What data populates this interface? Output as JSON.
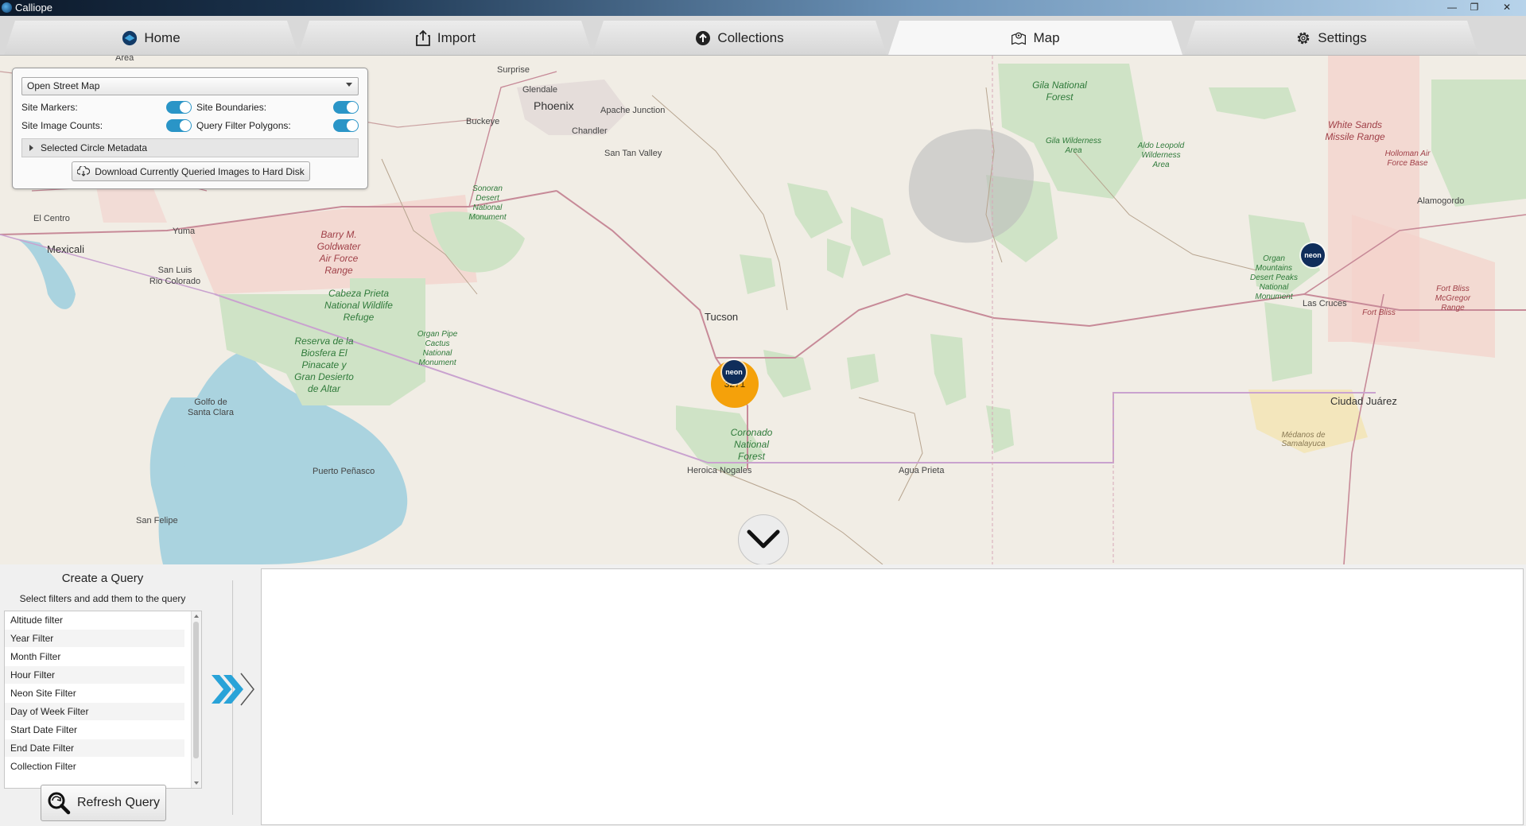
{
  "window": {
    "title": "Calliope",
    "controls": [
      "minimize-icon",
      "restore-icon",
      "close-icon"
    ]
  },
  "tabs": [
    {
      "label": "Home",
      "icon": "calliope-logo-icon",
      "active": false
    },
    {
      "label": "Import",
      "icon": "import-icon",
      "active": false
    },
    {
      "label": "Collections",
      "icon": "upload-circle-icon",
      "active": false
    },
    {
      "label": "Map",
      "icon": "map-pin-icon",
      "active": true
    },
    {
      "label": "Settings",
      "icon": "gear-icon",
      "active": false
    }
  ],
  "map_panel": {
    "layer": "Open Street Map",
    "site_markers_label": "Site Markers:",
    "site_markers_on": true,
    "site_boundaries_label": "Site Boundaries:",
    "site_boundaries_on": true,
    "site_image_counts_label": "Site Image Counts:",
    "site_image_counts_on": true,
    "query_filter_polygons_label": "Query Filter Polygons:",
    "query_filter_polygons_on": true,
    "metadata_label": "Selected Circle Metadata",
    "download_label": "Download Currently Queried Images to Hard Disk"
  },
  "map": {
    "markers": [
      {
        "label": "neon",
        "type": "neon-site-marker"
      },
      {
        "label": "neon",
        "type": "neon-site-marker"
      }
    ],
    "cluster_count": "3271",
    "labels": {
      "area": "Area",
      "surprise": "Surprise",
      "glendale": "Glendale",
      "phoenix": "Phoenix",
      "apache_junction": "Apache Junction",
      "buckeye": "Buckeye",
      "chandler": "Chandler",
      "san_tan_valley": "San Tan Valley",
      "el_centro": "El Centro",
      "yuma": "Yuma",
      "mexicali": "Mexicali",
      "san_luis": "San Luis\nRio Colorado",
      "sonoran": "Sonoran Desert National Monument",
      "barry": "Barry M. Goldwater Air Force Range",
      "cabeza": "Cabeza Prieta National Wildlife Refuge",
      "organ_pipe": "Organ Pipe Cactus National Monument",
      "reserva": "Reserva de la Biosfera El Pinacate y Gran Desierto de Altar",
      "tucson": "Tucson",
      "golfo": "Golfo de\nSanta Clara",
      "puerto": "Puerto Peñasco",
      "san_felipe": "San Felipe",
      "heroica": "Heroica Nogales",
      "agua_prieta": "Agua Prieta",
      "coronado": "Coronado National Forest",
      "gila_nf": "Gila National Forest",
      "gila_wild": "Gila Wilderness Area",
      "aldo": "Aldo Leopold Wilderness Area",
      "white_sands": "White Sands Missile Range",
      "holloman": "Holloman Air Force Base",
      "alamogordo": "Alamogordo",
      "organ_mtn": "Organ Mountains Desert Peaks National Monument",
      "las_cruces": "Las Cruces",
      "fort_bliss": "Fort Bliss",
      "fort_bliss_mcg": "Fort Bliss McGregor Range",
      "ciudad_juarez": "Ciudad Juárez",
      "medanos": "Médanos de Samalayuca"
    },
    "collapse_icon": "chevron-down-icon"
  },
  "query": {
    "title": "Create a Query",
    "subtitle": "Select filters and add them to the query",
    "filters": [
      "Altitude filter",
      "Year Filter",
      "Month Filter",
      "Hour Filter",
      "Neon Site Filter",
      "Day of Week Filter",
      "Start Date Filter",
      "End Date Filter",
      "Collection Filter"
    ],
    "add_icon": "double-chevron-right-icon",
    "refresh_label": "Refresh Query"
  },
  "colors": {
    "toggle_on": "#2a95c7",
    "cluster": "#f5a10a",
    "neon_marker": "#0f2d5a",
    "add_arrow": "#29a3d8",
    "park_green": "#cfe3c6",
    "military": "#f3d1cb",
    "water": "#aad3df"
  }
}
